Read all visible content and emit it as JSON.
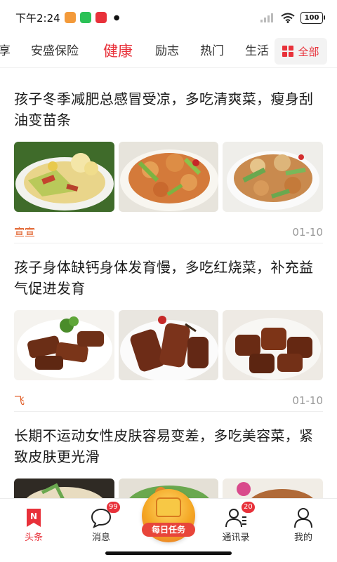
{
  "status_bar": {
    "time": "下午2:24",
    "battery": "100"
  },
  "categories": {
    "tabs": [
      "享",
      "安盛保险",
      "健康",
      "励志",
      "热门",
      "生活"
    ],
    "active_tab": "健康",
    "all_label": "全部"
  },
  "articles": [
    {
      "title": "孩子冬季减肥总感冒受凉，多吃清爽菜，瘦身刮油变苗条",
      "author": "宣宣",
      "date": "01-10",
      "images": [
        "cauliflower-stir-fry-1",
        "cauliflower-stir-fry-2",
        "cauliflower-stir-fry-3"
      ]
    },
    {
      "title": "孩子身体缺钙身体发育慢，多吃红烧菜，补充益气促进发育",
      "author": "飞",
      "date": "01-10",
      "images": [
        "braised-ribs-1",
        "braised-ribs-2",
        "braised-ribs-3"
      ]
    },
    {
      "title": "长期不运动女性皮肤容易变差，多吃美容菜，紧致皮肤更光滑",
      "author": "",
      "date": "",
      "images": [
        "dish-1",
        "dish-2",
        "dish-3"
      ]
    }
  ],
  "bottom_nav": {
    "items": [
      {
        "label": "头条",
        "icon": "news-icon",
        "badge": ""
      },
      {
        "label": "消息",
        "icon": "chat-bubble-icon",
        "badge": "99"
      },
      {
        "label": "每日任务",
        "icon": "treasure-chest-icon",
        "badge": ""
      },
      {
        "label": "通讯录",
        "icon": "contacts-icon",
        "badge": "20"
      },
      {
        "label": "我的",
        "icon": "user-icon",
        "badge": ""
      }
    ]
  },
  "colors": {
    "accent": "#e8313a",
    "author": "#e05a22"
  }
}
